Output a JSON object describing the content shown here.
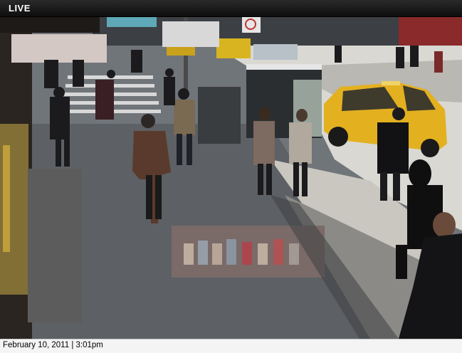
{
  "header": {
    "status_label": "LIVE"
  },
  "footer": {
    "timestamp": "February 10, 2011 | 3:01pm"
  },
  "feed": {
    "description_icon": "camera-feed"
  }
}
